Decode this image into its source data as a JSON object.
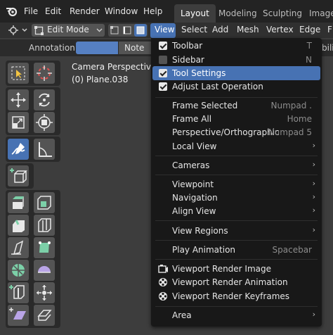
{
  "topbar": {
    "menus": [
      "File",
      "Edit",
      "Render",
      "Window",
      "Help"
    ],
    "workspaces": [
      "Layout",
      "Modeling",
      "Sculpting",
      "Image"
    ],
    "active_workspace": "Layout"
  },
  "header": {
    "mode": "Edit Mode",
    "menus": [
      "View",
      "Select",
      "Add",
      "Mesh",
      "Vertex",
      "Edge",
      "F"
    ]
  },
  "annotation": {
    "label": "Annotation:",
    "placement": "Note",
    "trailing": "bili"
  },
  "viewport": {
    "title": "Camera Perspective",
    "object": "(0) Plane.038"
  },
  "menu": {
    "items": [
      {
        "label": "Toolbar",
        "shortcut": "T",
        "type": "check",
        "checked": true
      },
      {
        "label": "Sidebar",
        "shortcut": "N",
        "type": "check",
        "checked": false
      },
      {
        "label": "Tool Settings",
        "shortcut": "",
        "type": "check",
        "checked": true,
        "highlighted": true
      },
      {
        "label": "Adjust Last Operation",
        "shortcut": "",
        "type": "check",
        "checked": true
      },
      {
        "label": "Frame Selected",
        "shortcut": "Numpad .",
        "type": "item"
      },
      {
        "label": "Frame All",
        "shortcut": "Home",
        "type": "item"
      },
      {
        "label": "Perspective/Orthographic",
        "shortcut": "Numpad 5",
        "type": "item"
      },
      {
        "label": "Local View",
        "shortcut": "",
        "type": "submenu"
      },
      {
        "label": "Cameras",
        "shortcut": "",
        "type": "submenu"
      },
      {
        "label": "Viewpoint",
        "shortcut": "",
        "type": "submenu"
      },
      {
        "label": "Navigation",
        "shortcut": "",
        "type": "submenu"
      },
      {
        "label": "Align View",
        "shortcut": "",
        "type": "submenu"
      },
      {
        "label": "View Regions",
        "shortcut": "",
        "type": "submenu"
      },
      {
        "label": "Play Animation",
        "shortcut": "Spacebar",
        "type": "item"
      },
      {
        "label": "Viewport Render Image",
        "shortcut": "",
        "type": "icon",
        "icon": "render-image-icon"
      },
      {
        "label": "Viewport Render Animation",
        "shortcut": "",
        "type": "icon",
        "icon": "render-animation-icon"
      },
      {
        "label": "Viewport Render Keyframes",
        "shortcut": "",
        "type": "icon",
        "icon": "render-keyframes-icon"
      },
      {
        "label": "Area",
        "shortcut": "",
        "type": "submenu"
      }
    ],
    "submenu_arrow": "›"
  },
  "colors": {
    "accent": "#4772b3",
    "menu_bg": "#181818",
    "tool_green": "#7cd0a8"
  }
}
